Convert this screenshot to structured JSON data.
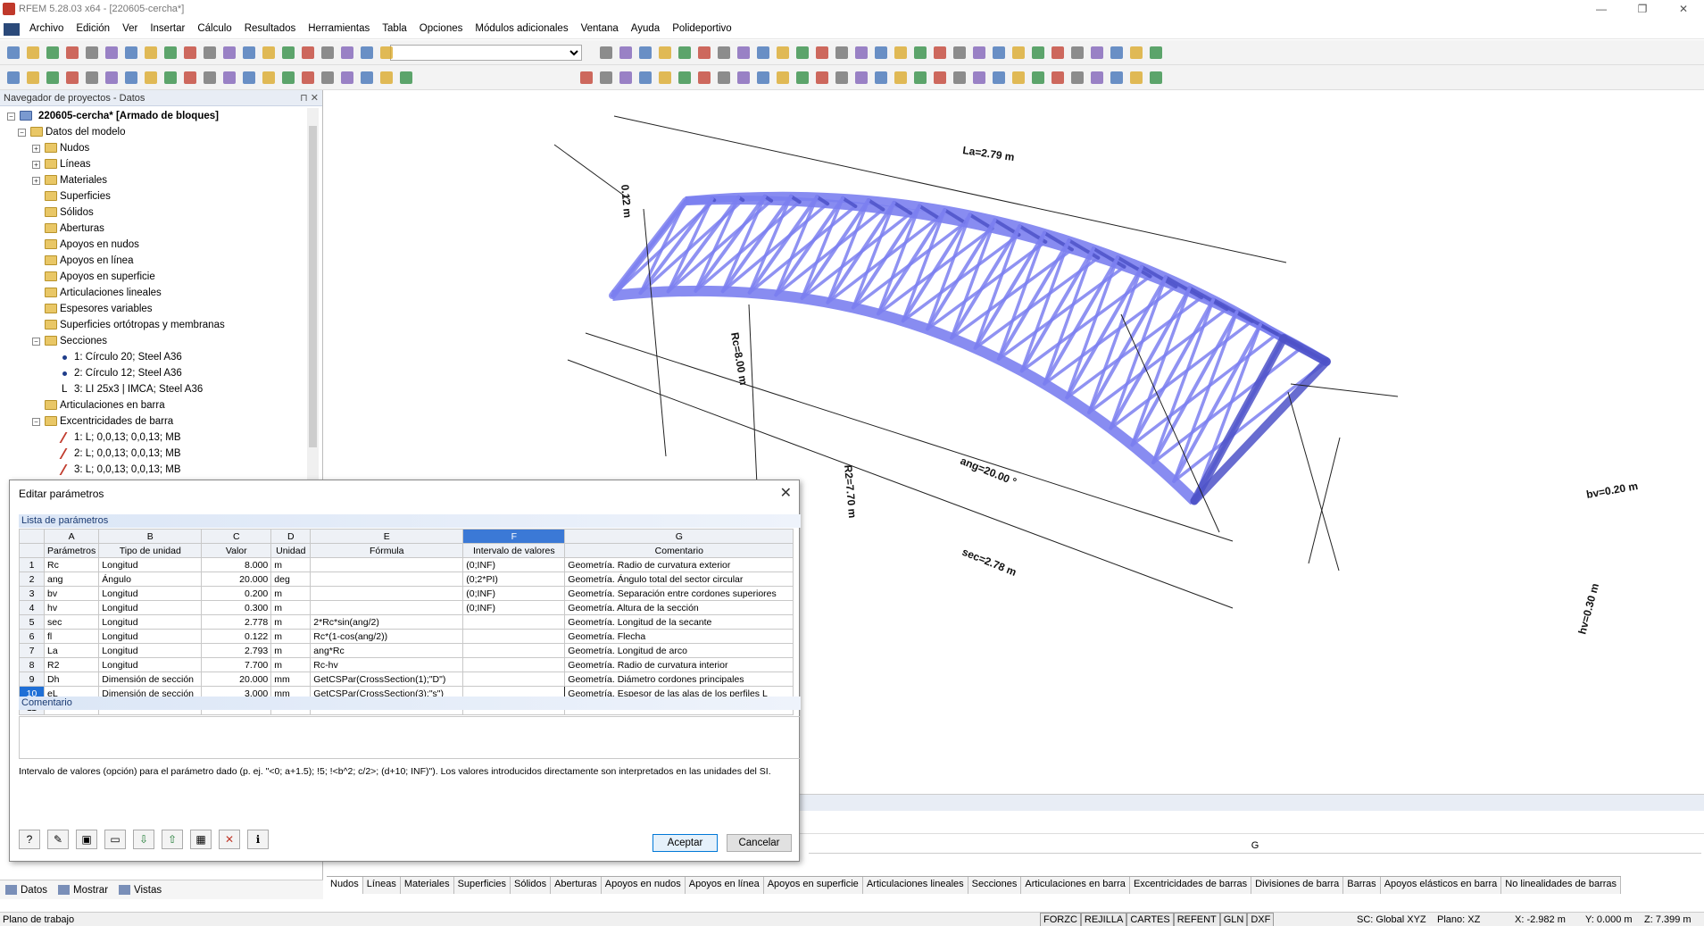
{
  "window": {
    "title": "RFEM 5.28.03 x64 - [220605-cercha*]",
    "buttons": [
      "—",
      "❐",
      "✕"
    ]
  },
  "menu": [
    "Archivo",
    "Edición",
    "Ver",
    "Insertar",
    "Cálculo",
    "Resultados",
    "Herramientas",
    "Tabla",
    "Opciones",
    "Módulos adicionales",
    "Ventana",
    "Ayuda",
    "Polideportivo"
  ],
  "navigator": {
    "header": "Navegador de proyectos - Datos",
    "root": "220605-cercha* [Armado de bloques]",
    "items": [
      {
        "label": "Datos del modelo",
        "level": 1,
        "exp": "−",
        "icon": "folder"
      },
      {
        "label": "Nudos",
        "level": 2,
        "exp": "+",
        "icon": "folder"
      },
      {
        "label": "Líneas",
        "level": 2,
        "exp": "+",
        "icon": "folder"
      },
      {
        "label": "Materiales",
        "level": 2,
        "exp": "+",
        "icon": "folder"
      },
      {
        "label": "Superficies",
        "level": 2,
        "exp": "",
        "icon": "folder"
      },
      {
        "label": "Sólidos",
        "level": 2,
        "exp": "",
        "icon": "folder"
      },
      {
        "label": "Aberturas",
        "level": 2,
        "exp": "",
        "icon": "folder"
      },
      {
        "label": "Apoyos en nudos",
        "level": 2,
        "exp": "",
        "icon": "folder"
      },
      {
        "label": "Apoyos en línea",
        "level": 2,
        "exp": "",
        "icon": "folder"
      },
      {
        "label": "Apoyos en superficie",
        "level": 2,
        "exp": "",
        "icon": "folder"
      },
      {
        "label": "Articulaciones lineales",
        "level": 2,
        "exp": "",
        "icon": "folder"
      },
      {
        "label": "Espesores variables",
        "level": 2,
        "exp": "",
        "icon": "folder"
      },
      {
        "label": "Superficies ortótropas y membranas",
        "level": 2,
        "exp": "",
        "icon": "folder"
      },
      {
        "label": "Secciones",
        "level": 2,
        "exp": "−",
        "icon": "folder"
      },
      {
        "label": "1: Círculo 20; Steel A36",
        "level": 3,
        "exp": "",
        "icon": "bullet"
      },
      {
        "label": "2: Círculo 12; Steel A36",
        "level": 3,
        "exp": "",
        "icon": "bullet"
      },
      {
        "label": "3: LI 25x3 | IMCA; Steel A36",
        "level": 3,
        "exp": "",
        "icon": "angle"
      },
      {
        "label": "Articulaciones en barra",
        "level": 2,
        "exp": "",
        "icon": "folder"
      },
      {
        "label": "Excentricidades de barra",
        "level": 2,
        "exp": "−",
        "icon": "folder"
      },
      {
        "label": "1: L; 0,0,13; 0,0,13; MB",
        "level": 3,
        "exp": "",
        "icon": "ecc"
      },
      {
        "label": "2: L; 0,0,13; 0,0,13; MB",
        "level": 3,
        "exp": "",
        "icon": "ecc"
      },
      {
        "label": "3: L; 0,0,13; 0,0,13; MB",
        "level": 3,
        "exp": "",
        "icon": "ecc"
      }
    ],
    "tabs": [
      "Datos",
      "Mostrar",
      "Vistas"
    ]
  },
  "viewport": {
    "labels": {
      "La": "La=2.79 m",
      "fl": "0.12 m",
      "Rc": "Rc=8.00 m",
      "R2": "R2=7.70 m",
      "ang": "ang=20.00 °",
      "sec": "sec=2.78 m",
      "bv": "bv=0.20 m",
      "hv": "hv=0.30 m"
    }
  },
  "dialog": {
    "title": "Editar parámetros",
    "list_header": "Lista de parámetros",
    "col_letters": [
      "A",
      "B",
      "C",
      "D",
      "E",
      "F",
      "G"
    ],
    "col_names": [
      "Parámetros",
      "Tipo de unidad",
      "Valor",
      "Unidad",
      "Fórmula",
      "Intervalo de valores",
      "Comentario"
    ],
    "rows": [
      {
        "n": "1",
        "name": "Rc",
        "type": "Longitud",
        "value": "8.000",
        "unit": "m",
        "formula": "",
        "range": "(0;INF)",
        "comment": "Geometría. Radio de curvatura exterior"
      },
      {
        "n": "2",
        "name": "ang",
        "type": "Ángulo",
        "value": "20.000",
        "unit": "deg",
        "formula": "",
        "range": "(0;2*PI)",
        "comment": "Geometría. Ángulo total del sector circular"
      },
      {
        "n": "3",
        "name": "bv",
        "type": "Longitud",
        "value": "0.200",
        "unit": "m",
        "formula": "",
        "range": "(0;INF)",
        "comment": "Geometría. Separación entre cordones superiores"
      },
      {
        "n": "4",
        "name": "hv",
        "type": "Longitud",
        "value": "0.300",
        "unit": "m",
        "formula": "",
        "range": "(0;INF)",
        "comment": "Geometría. Altura de la sección"
      },
      {
        "n": "5",
        "name": "sec",
        "type": "Longitud",
        "value": "2.778",
        "unit": "m",
        "formula": "2*Rc*sin(ang/2)",
        "range": "",
        "comment": "Geometría. Longitud de la secante"
      },
      {
        "n": "6",
        "name": "fl",
        "type": "Longitud",
        "value": "0.122",
        "unit": "m",
        "formula": "Rc*(1-cos(ang/2))",
        "range": "",
        "comment": "Geometría. Flecha"
      },
      {
        "n": "7",
        "name": "La",
        "type": "Longitud",
        "value": "2.793",
        "unit": "m",
        "formula": "ang*Rc",
        "range": "",
        "comment": "Geometría. Longitud de arco"
      },
      {
        "n": "8",
        "name": "R2",
        "type": "Longitud",
        "value": "7.700",
        "unit": "m",
        "formula": "Rc-hv",
        "range": "",
        "comment": "Geometría. Radio de curvatura interior"
      },
      {
        "n": "9",
        "name": "Dh",
        "type": "Dimensión de sección",
        "value": "20.000",
        "unit": "mm",
        "formula": "GetCSPar(CrossSection(1);\"D\")",
        "range": "",
        "comment": "Geometría. Diámetro cordones principales"
      },
      {
        "n": "10",
        "name": "eL",
        "type": "Dimensión de sección",
        "value": "3.000",
        "unit": "mm",
        "formula": "GetCSPar(CrossSection(3);\"s\")",
        "range": "",
        "comment": "Geometría. Espesor de las alas de los perfiles L"
      },
      {
        "n": "11",
        "name": "",
        "type": "",
        "value": "",
        "unit": "",
        "formula": "",
        "range": "",
        "comment": ""
      }
    ],
    "comment_header": "Comentario",
    "help": "Intervalo de valores (opción) para el parámetro dado (p. ej. \"<0; a+1.5); !5; !<b^2; c/2>; (d+10; INF)\"). Los valores introducidos directamente son interpretados en las unidades del SI.",
    "ok": "Aceptar",
    "cancel": "Cancelar"
  },
  "bottom": {
    "colgroup": "G",
    "tabs": [
      "Nudos",
      "Líneas",
      "Materiales",
      "Superficies",
      "Sólidos",
      "Aberturas",
      "Apoyos en nudos",
      "Apoyos en línea",
      "Apoyos en superficie",
      "Articulaciones lineales",
      "Secciones",
      "Articulaciones en barra",
      "Excentricidades de barras",
      "Divisiones de barra",
      "Barras",
      "Apoyos elásticos en barra",
      "No linealidades de barras"
    ]
  },
  "status": {
    "left": "Plano de trabajo",
    "buttons": [
      "FORZC",
      "REJILLA",
      "CARTES",
      "REFENT",
      "GLN",
      "DXF"
    ],
    "sc": "SC: Global XYZ",
    "plane": "Plano: XZ",
    "x": "X: -2.982 m",
    "y": "Y: 0.000 m",
    "z": "Z: 7.399 m"
  },
  "colors": {
    "truss": "#7b7ff0",
    "truss_dark": "#4d52c8",
    "dim": "#222",
    "accent": "#1f6fd6"
  }
}
